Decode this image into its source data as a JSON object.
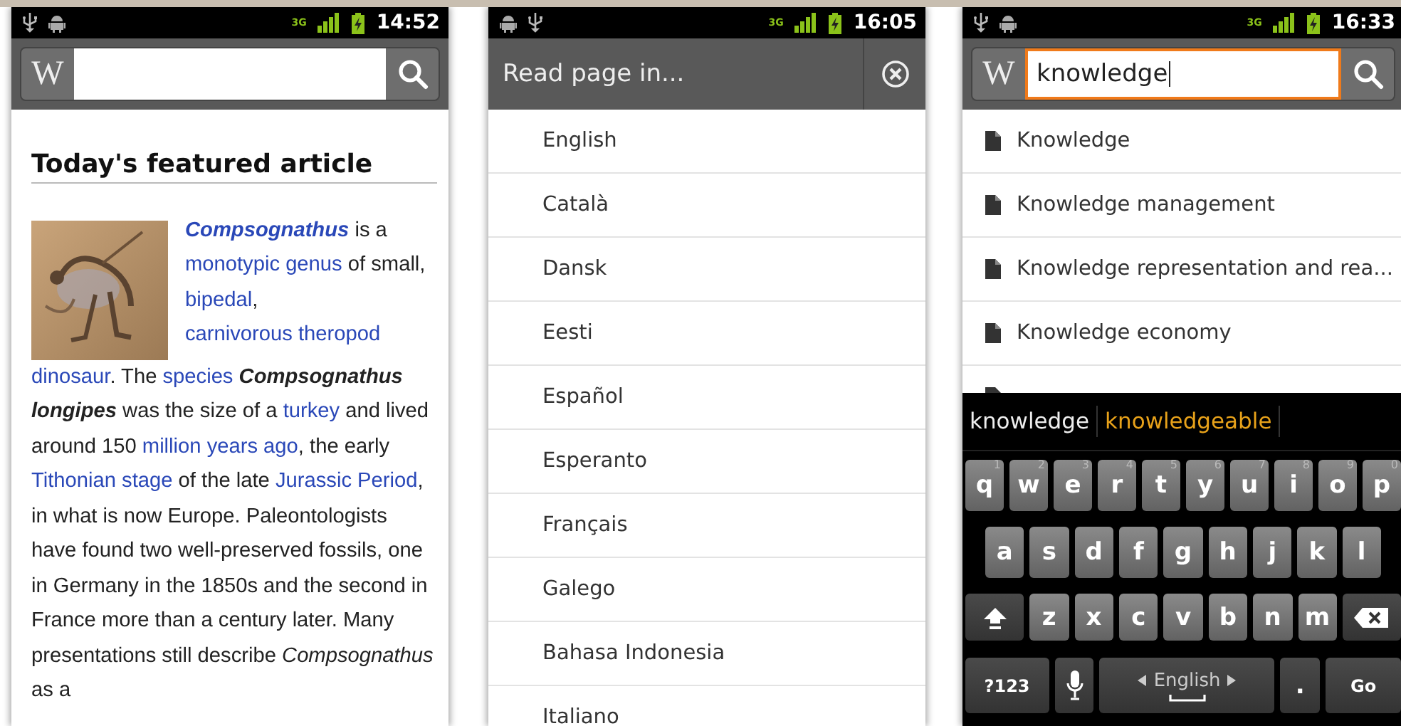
{
  "phones": [
    {
      "kind": "article",
      "status_bar": {
        "left_icons": [
          {
            "kind": "usb"
          },
          {
            "kind": "android"
          }
        ],
        "network": "3G",
        "time": "14:52"
      },
      "header": {
        "kind": "search",
        "logo": "W",
        "focused": false
      },
      "article": {
        "heading": "Today's featured article",
        "intro": [
          {
            "kind": "taxonlink",
            "text": "Compsognathus"
          },
          {
            "kind": "text",
            "text": " is a "
          },
          {
            "kind": "link",
            "text": "monotypic genus"
          },
          {
            "kind": "text",
            "text": " of small, "
          },
          {
            "kind": "link",
            "text": "bipedal"
          },
          {
            "kind": "text",
            "text": ", "
          },
          {
            "kind": "link",
            "text": "carnivorous theropod"
          }
        ],
        "body": [
          {
            "kind": "link",
            "text": "dinosaur"
          },
          {
            "kind": "text",
            "text": ". The "
          },
          {
            "kind": "link",
            "text": "species"
          },
          {
            "kind": "taxon",
            "text": " Compsognathus longipes"
          },
          {
            "kind": "text",
            "text": " was the size of a "
          },
          {
            "kind": "link",
            "text": "turkey"
          },
          {
            "kind": "text",
            "text": " and lived around 150 "
          },
          {
            "kind": "link",
            "text": "million years ago"
          },
          {
            "kind": "text",
            "text": ", the early "
          },
          {
            "kind": "link",
            "text": "Tithonian stage"
          },
          {
            "kind": "text",
            "text": " of the late "
          },
          {
            "kind": "link",
            "text": "Jurassic Period"
          },
          {
            "kind": "text",
            "text": ", in what is now Europe. Paleontologists have found two well-preserved fossils, one in Germany in the 1850s and the second in France more than a century later. Many presentations still describe *Compsognathus* as a"
          }
        ]
      }
    },
    {
      "kind": "languages",
      "status_bar": {
        "left_icons": [
          {
            "kind": "android"
          },
          {
            "kind": "usb"
          }
        ],
        "network": "3G",
        "time": "16:05"
      },
      "header": {
        "kind": "dialog",
        "title": "Read page in..."
      },
      "languages": [
        "English",
        "Català",
        "Dansk",
        "Eesti",
        "Español",
        "Esperanto",
        "Français",
        "Galego",
        "Bahasa Indonesia",
        "Italiano"
      ]
    },
    {
      "kind": "search",
      "status_bar": {
        "left_icons": [
          {
            "kind": "usb"
          },
          {
            "kind": "android"
          }
        ],
        "network": "3G",
        "time": "16:33"
      },
      "header": {
        "kind": "search",
        "logo": "W",
        "value": "knowledge",
        "focused": true
      },
      "results": [
        "Knowledge",
        "Knowledge management",
        "Knowledge representation and rea...",
        "Knowledge economy"
      ],
      "keyboard": {
        "suggestions": [
          {
            "text": "knowledge",
            "selected": false
          },
          {
            "text": "knowledgeable",
            "selected": true
          }
        ],
        "rows": [
          {
            "keys": [
              {
                "kind": "letter",
                "label": "q",
                "hint": "1"
              },
              {
                "kind": "letter",
                "label": "w",
                "hint": "2"
              },
              {
                "kind": "letter",
                "label": "e",
                "hint": "3"
              },
              {
                "kind": "letter",
                "label": "r",
                "hint": "4"
              },
              {
                "kind": "letter",
                "label": "t",
                "hint": "5"
              },
              {
                "kind": "letter",
                "label": "y",
                "hint": "6"
              },
              {
                "kind": "letter",
                "label": "u",
                "hint": "7"
              },
              {
                "kind": "letter",
                "label": "i",
                "hint": "8"
              },
              {
                "kind": "letter",
                "label": "o",
                "hint": "9"
              },
              {
                "kind": "letter",
                "label": "p",
                "hint": "0"
              }
            ]
          },
          {
            "keys": [
              {
                "kind": "letter",
                "label": "a"
              },
              {
                "kind": "letter",
                "label": "s"
              },
              {
                "kind": "letter",
                "label": "d"
              },
              {
                "kind": "letter",
                "label": "f"
              },
              {
                "kind": "letter",
                "label": "g"
              },
              {
                "kind": "letter",
                "label": "h"
              },
              {
                "kind": "letter",
                "label": "j"
              },
              {
                "kind": "letter",
                "label": "k"
              },
              {
                "kind": "letter",
                "label": "l"
              }
            ]
          },
          {
            "keys": [
              {
                "kind": "shift"
              },
              {
                "kind": "letter",
                "label": "z"
              },
              {
                "kind": "letter",
                "label": "x"
              },
              {
                "kind": "letter",
                "label": "c"
              },
              {
                "kind": "letter",
                "label": "v"
              },
              {
                "kind": "letter",
                "label": "b"
              },
              {
                "kind": "letter",
                "label": "n"
              },
              {
                "kind": "letter",
                "label": "m"
              },
              {
                "kind": "backspace"
              }
            ]
          },
          {
            "keys": [
              {
                "kind": "symbols",
                "label": "?123"
              },
              {
                "kind": "mic"
              },
              {
                "kind": "space",
                "label": "English"
              },
              {
                "kind": "period",
                "label": "."
              },
              {
                "kind": "go",
                "label": "Go"
              }
            ]
          }
        ]
      }
    }
  ]
}
